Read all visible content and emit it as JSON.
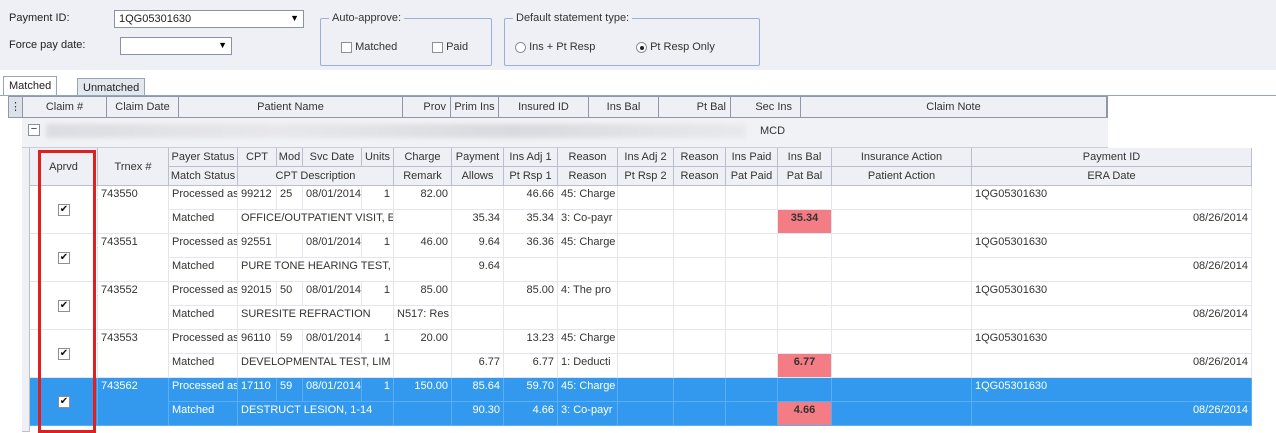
{
  "header": {
    "payment_id_label": "Payment ID:",
    "payment_id_value": "1QG05301630",
    "force_pay_date_label": "Force pay date:",
    "force_pay_date_value": "",
    "auto_approve": {
      "title": "Auto-approve:",
      "matched_label": "Matched",
      "paid_label": "Paid"
    },
    "statement_type": {
      "title": "Default statement type:",
      "opt1": "Ins + Pt Resp",
      "opt2": "Pt Resp Only",
      "selected": "Pt Resp Only"
    }
  },
  "tabs": [
    "Matched",
    "Unmatched"
  ],
  "summary_columns": [
    "Claim #",
    "Claim Date",
    "Patient Name",
    "Prov",
    "Prim Ins",
    "Insured ID",
    "Ins Bal",
    "Pt Bal",
    "Sec Ins",
    "Claim Note"
  ],
  "group_row": {
    "toggle": "−",
    "sec_ins": "MCD"
  },
  "detail_header_row1": [
    "Aprvd",
    "Trnex #",
    "Payer Status",
    "CPT",
    "Mod",
    "Svc Date",
    "Units",
    "Charge",
    "Payment",
    "Ins Adj 1",
    "Reason",
    "Ins Adj 2",
    "Reason",
    "Ins Paid",
    "Ins Bal",
    "Insurance Action",
    "Payment ID"
  ],
  "detail_header_row2": [
    "Match Status",
    "CPT Description",
    "Remark",
    "Allows",
    "Pt Rsp 1",
    "Reason",
    "Pt Rsp 2",
    "Reason",
    "Pat Paid",
    "Pat Bal",
    "Patient Action",
    "ERA Date"
  ],
  "rows": [
    {
      "approved": true,
      "trnex": "743550",
      "payer_status": "Processed as",
      "cpt": "99212",
      "mod": "25",
      "svc_date": "08/01/2014",
      "units": "1",
      "charge": "82.00",
      "payment": "",
      "ins_adj1": "46.66",
      "reason1": "45: Charge",
      "payment_id": "1QG05301630",
      "match_status": "Matched",
      "cpt_desc": "OFFICE/OUTPATIENT VISIT, EST",
      "remark": "",
      "allows": "35.34",
      "pt_rsp1": "35.34",
      "pt_reason": "3: Co-payr",
      "pat_bal": "35.34",
      "pat_bal_highlight": true,
      "era_date": "08/26/2014",
      "selected": false
    },
    {
      "approved": true,
      "trnex": "743551",
      "payer_status": "Processed as",
      "cpt": "92551",
      "mod": "",
      "svc_date": "08/01/2014",
      "units": "1",
      "charge": "46.00",
      "payment": "9.64",
      "ins_adj1": "36.36",
      "reason1": "45: Charge",
      "payment_id": "1QG05301630",
      "match_status": "Matched",
      "cpt_desc": "PURE TONE HEARING TEST, AIR",
      "remark": "",
      "allows": "9.64",
      "pt_rsp1": "",
      "pt_reason": "",
      "pat_bal": "",
      "pat_bal_highlight": false,
      "era_date": "08/26/2014",
      "selected": false
    },
    {
      "approved": true,
      "trnex": "743552",
      "payer_status": "Processed as",
      "cpt": "92015",
      "mod": "50",
      "svc_date": "08/01/2014",
      "units": "1",
      "charge": "85.00",
      "payment": "",
      "ins_adj1": "85.00",
      "reason1": "4: The pro",
      "payment_id": "1QG05301630",
      "match_status": "Matched",
      "cpt_desc": "SURESITE REFRACTION",
      "remark": "N517: Res",
      "allows": "",
      "pt_rsp1": "",
      "pt_reason": "",
      "pat_bal": "",
      "pat_bal_highlight": false,
      "era_date": "08/26/2014",
      "selected": false
    },
    {
      "approved": true,
      "trnex": "743553",
      "payer_status": "Processed as",
      "cpt": "96110",
      "mod": "59",
      "svc_date": "08/01/2014",
      "units": "1",
      "charge": "20.00",
      "payment": "",
      "ins_adj1": "13.23",
      "reason1": "45: Charge",
      "payment_id": "1QG05301630",
      "match_status": "Matched",
      "cpt_desc": "DEVELOPMENTAL TEST, LIM",
      "remark": "",
      "allows": "6.77",
      "pt_rsp1": "6.77",
      "pt_reason": "1: Deducti",
      "pat_bal": "6.77",
      "pat_bal_highlight": true,
      "era_date": "08/26/2014",
      "selected": false
    },
    {
      "approved": true,
      "trnex": "743562",
      "payer_status": "Processed as",
      "cpt": "17110",
      "mod": "59",
      "svc_date": "08/01/2014",
      "units": "1",
      "charge": "150.00",
      "payment": "85.64",
      "ins_adj1": "59.70",
      "reason1": "45: Charge",
      "payment_id": "1QG05301630",
      "match_status": "Matched",
      "cpt_desc": "DESTRUCT LESION, 1-14",
      "remark": "",
      "allows": "90.30",
      "pt_rsp1": "4.66",
      "pt_reason": "3: Co-payr",
      "pat_bal": "4.66",
      "pat_bal_highlight": true,
      "era_date": "08/26/2014",
      "selected": true
    }
  ],
  "colors": {
    "selected_row": "#3399ee",
    "highlight": "#f47c84",
    "annotation_box": "#e02020"
  }
}
